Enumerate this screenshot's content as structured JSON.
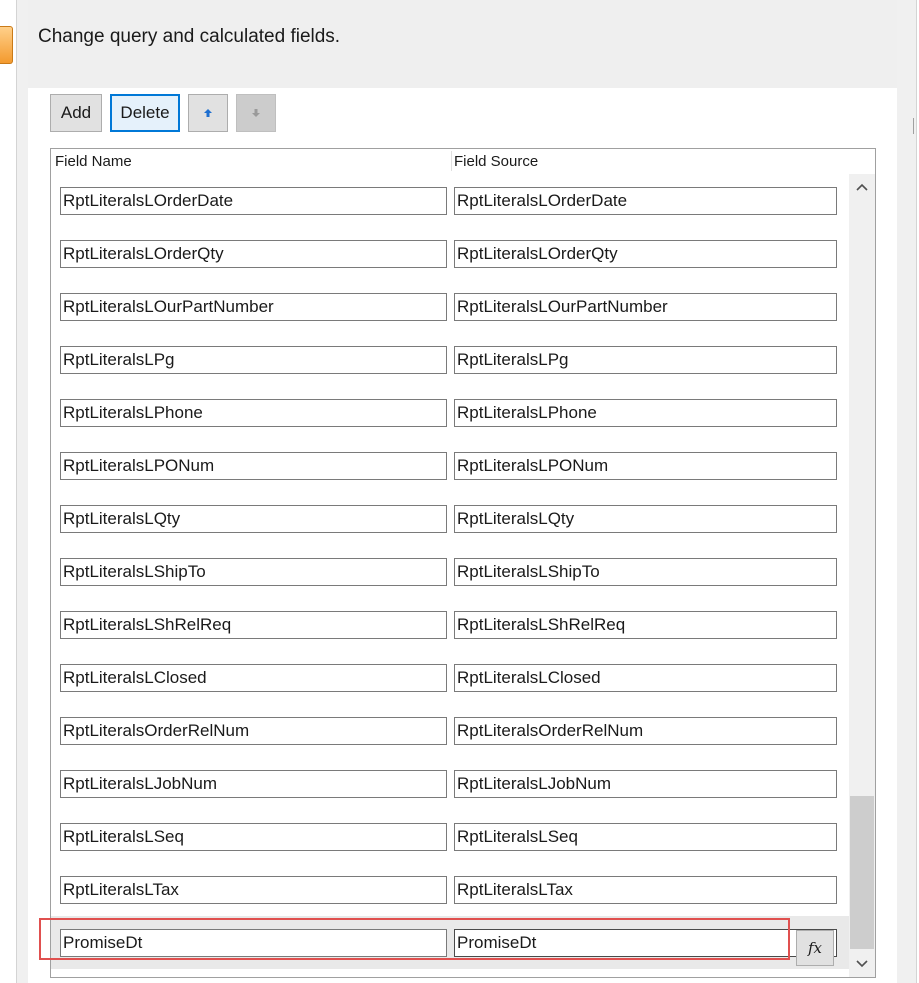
{
  "header": {
    "text": "Change query and calculated fields."
  },
  "toolbar": {
    "add_label": "Add",
    "delete_label": "Delete",
    "move_up_icon": "arrow-up-icon",
    "move_down_icon": "arrow-down-icon"
  },
  "grid": {
    "columns": {
      "field_name": "Field Name",
      "field_source": "Field Source"
    },
    "rows": [
      {
        "name": "RptLiteralsLOrderDate",
        "source": "RptLiteralsLOrderDate"
      },
      {
        "name": "RptLiteralsLOrderQty",
        "source": "RptLiteralsLOrderQty"
      },
      {
        "name": "RptLiteralsLOurPartNumber",
        "source": "RptLiteralsLOurPartNumber"
      },
      {
        "name": "RptLiteralsLPg",
        "source": "RptLiteralsLPg"
      },
      {
        "name": "RptLiteralsLPhone",
        "source": "RptLiteralsLPhone"
      },
      {
        "name": "RptLiteralsLPONum",
        "source": "RptLiteralsLPONum"
      },
      {
        "name": "RptLiteralsLQty",
        "source": "RptLiteralsLQty"
      },
      {
        "name": "RptLiteralsLShipTo",
        "source": "RptLiteralsLShipTo"
      },
      {
        "name": "RptLiteralsLShRelReq",
        "source": "RptLiteralsLShRelReq"
      },
      {
        "name": "RptLiteralsLClosed",
        "source": "RptLiteralsLClosed"
      },
      {
        "name": "RptLiteralsOrderRelNum",
        "source": "RptLiteralsOrderRelNum"
      },
      {
        "name": "RptLiteralsLJobNum",
        "source": "RptLiteralsLJobNum"
      },
      {
        "name": "RptLiteralsLSeq",
        "source": "RptLiteralsLSeq"
      },
      {
        "name": "RptLiteralsLTax",
        "source": "RptLiteralsLTax"
      },
      {
        "name": "PromiseDt",
        "source": "PromiseDt"
      }
    ],
    "fx_label": "fx",
    "highlight_color": "#e0504f"
  }
}
